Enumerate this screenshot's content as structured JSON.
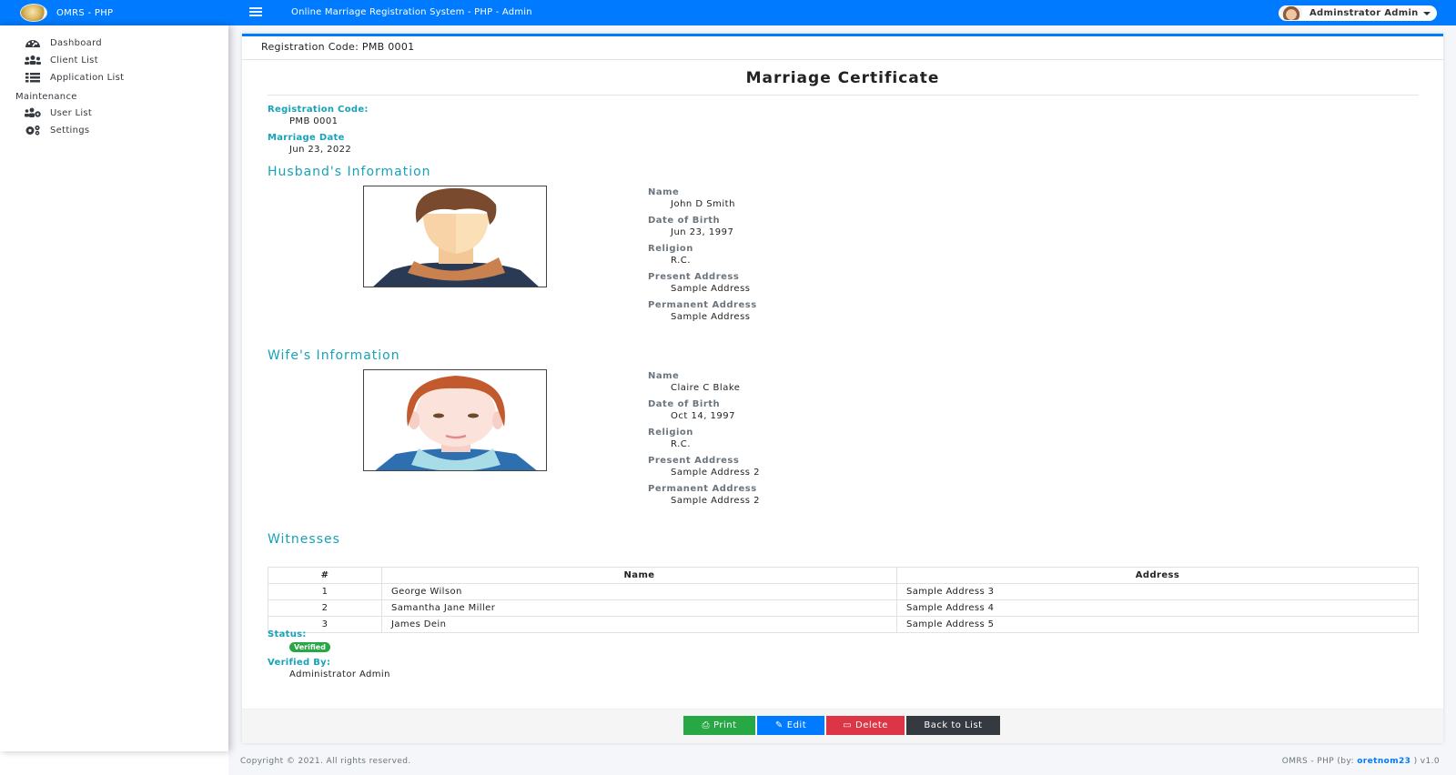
{
  "brand": {
    "name": "OMRS - PHP",
    "logo_icon": "rings-logo"
  },
  "topbar": {
    "title": "Online Marriage Registration System - PHP - Admin",
    "menu_icon": "hamburger-icon",
    "user_name": "Adminstrator Admin"
  },
  "sidebar": {
    "items": [
      {
        "label": "Dashboard",
        "icon": "tachometer-icon"
      },
      {
        "label": "Client List",
        "icon": "users-icon"
      },
      {
        "label": "Application List",
        "icon": "list-icon"
      }
    ],
    "section_header": "Maintenance",
    "maintenance_items": [
      {
        "label": "User List",
        "icon": "users-cog-icon"
      },
      {
        "label": "Settings",
        "icon": "cogs-icon"
      }
    ]
  },
  "card": {
    "header": "Registration Code: PMB 0001",
    "certificate_title": "Marriage Certificate",
    "registration_code_label": "Registration Code:",
    "registration_code": "PMB 0001",
    "marriage_date_label": "Marriage Date",
    "marriage_date": "Jun 23, 2022"
  },
  "husband": {
    "section_title": "Husband's Information",
    "name_label": "Name",
    "name": "John D Smith",
    "dob_label": "Date of Birth",
    "dob": "Jun 23, 1997",
    "religion_label": "Religion",
    "religion": "R.C.",
    "present_address_label": "Present Address",
    "present_address": "Sample Address",
    "permanent_address_label": "Permanent Address",
    "permanent_address": "Sample Address"
  },
  "wife": {
    "section_title": "Wife's Information",
    "name_label": "Name",
    "name": "Claire C Blake",
    "dob_label": "Date of Birth",
    "dob": "Oct 14, 1997",
    "religion_label": "Religion",
    "religion": "R.C.",
    "present_address_label": "Present Address",
    "present_address": "Sample Address 2",
    "permanent_address_label": "Permanent Address",
    "permanent_address": "Sample Address 2"
  },
  "witnesses": {
    "section_title": "Witnesses",
    "columns": [
      "#",
      "Name",
      "Address"
    ],
    "rows": [
      {
        "num": "1",
        "name": "George Wilson",
        "address": "Sample Address 3"
      },
      {
        "num": "2",
        "name": "Samantha Jane Miller",
        "address": "Sample Address 4"
      },
      {
        "num": "3",
        "name": "James Dein",
        "address": "Sample Address 5"
      }
    ]
  },
  "status": {
    "label": "Status:",
    "value": "Verified",
    "color": "#28a745"
  },
  "verified_by": {
    "label": "Verified By:",
    "value": "Administrator Admin"
  },
  "buttons": {
    "print": "Print",
    "edit": "Edit",
    "delete": "Delete",
    "back": "Back to List"
  },
  "colors": {
    "primary": "#007bff",
    "success": "#28a745",
    "danger": "#dc3545",
    "dark": "#343a40",
    "info": "#17a2b8"
  },
  "footer": {
    "copyright": "Copyright © 2021. All rights reserved.",
    "credit_prefix": "OMRS - PHP (by: ",
    "credit_link": "oretnom23",
    "credit_suffix": " ) v1.0"
  }
}
